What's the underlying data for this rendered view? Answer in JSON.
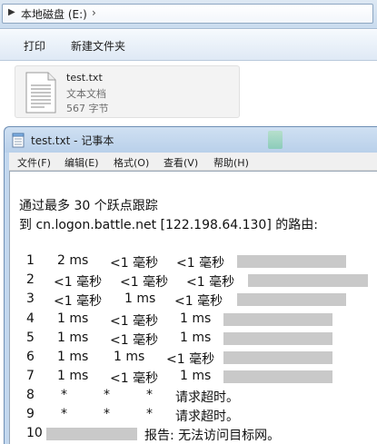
{
  "explorer": {
    "address": {
      "arrow_icon": "play-triangle-icon",
      "path": "本地磁盘 (E:)",
      "chevron": "›"
    },
    "toolbar": {
      "print_label": "打印",
      "new_folder_label": "新建文件夹"
    },
    "file": {
      "name": "test.txt",
      "type": "文本文档",
      "size": "567 字节"
    }
  },
  "notepad": {
    "title": "test.txt - 记事本",
    "menu": [
      {
        "label": "文件(F)"
      },
      {
        "label": "编辑(E)"
      },
      {
        "label": "格式(O)"
      },
      {
        "label": "查看(V)"
      },
      {
        "label": "帮助(H)"
      }
    ],
    "header_line1": "通过最多 30 个跃点跟踪",
    "header_line2": "到 cn.logon.battle.net [122.198.64.130] 的路由:",
    "hops": [
      {
        "num": "1",
        "t1": "2 ms",
        "t2": "<1 毫秒",
        "t3": "<1 毫秒",
        "note": ""
      },
      {
        "num": "2",
        "t1": "<1 毫秒",
        "t2": "<1 毫秒",
        "t3": "<1 毫秒",
        "note": ""
      },
      {
        "num": "3",
        "t1": "<1 毫秒",
        "t2": "1 ms",
        "t3": "<1 毫秒",
        "note": ""
      },
      {
        "num": "4",
        "t1": "1 ms",
        "t2": "<1 毫秒",
        "t3": "1 ms",
        "note": ""
      },
      {
        "num": "5",
        "t1": "1 ms",
        "t2": "<1 毫秒",
        "t3": "1 ms",
        "note": ""
      },
      {
        "num": "6",
        "t1": "1 ms",
        "t2": "1 ms",
        "t3": "<1 毫秒",
        "note": ""
      },
      {
        "num": "7",
        "t1": "1 ms",
        "t2": "<1 毫秒",
        "t3": "1 ms",
        "note": ""
      },
      {
        "num": "8",
        "t1": "*",
        "t2": "*",
        "t3": "*",
        "note": "请求超时。"
      },
      {
        "num": "9",
        "t1": "*",
        "t2": "*",
        "t3": "*",
        "note": "请求超时。"
      },
      {
        "num": "10",
        "t1": "",
        "t2": "",
        "t3": "",
        "note": "报告: 无法访问目标网。"
      }
    ]
  }
}
